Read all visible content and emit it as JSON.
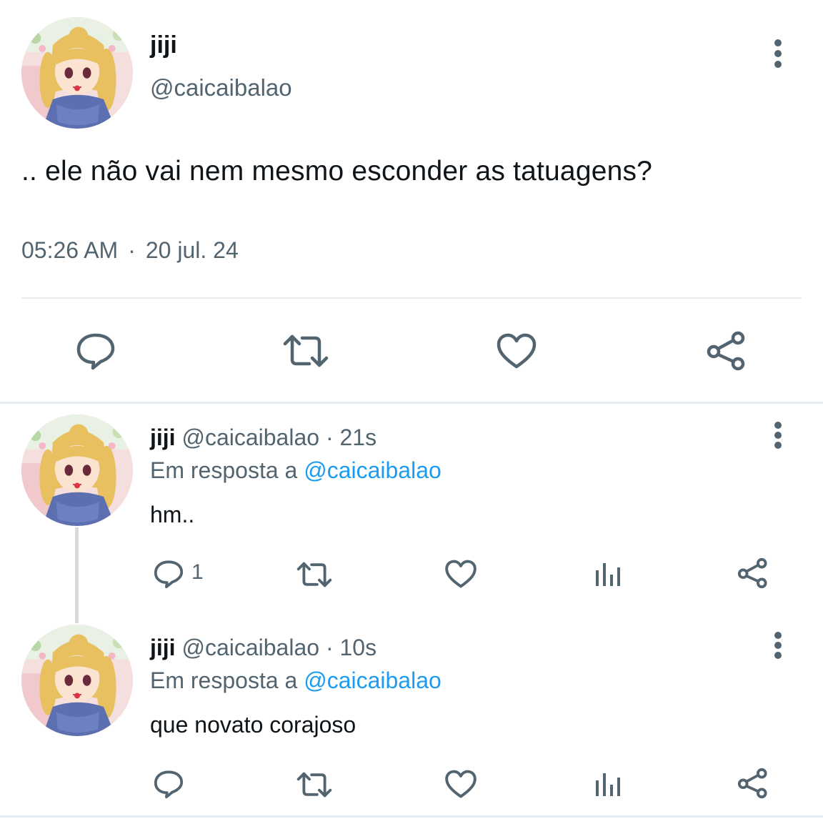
{
  "main_tweet": {
    "display_name": "jiji",
    "handle": "@caicaibalao",
    "text": ".. ele não vai nem mesmo esconder as tatuagens?",
    "time": "05:26 AM",
    "separator": "·",
    "date": "20 jul. 24",
    "actions": [
      "reply-icon",
      "retweet-icon",
      "like-icon",
      "share-icon"
    ]
  },
  "replies": [
    {
      "display_name": "jiji",
      "handle": "@caicaibalao",
      "age": "· 21s",
      "reply_prefix": "Em resposta a",
      "reply_to": "@caicaibalao",
      "text": "hm..",
      "reply_count": "1"
    },
    {
      "display_name": "jiji",
      "handle": "@caicaibalao",
      "age": "· 10s",
      "reply_prefix": "Em resposta a",
      "reply_to": "@caicaibalao",
      "text": "que novato corajoso",
      "reply_count": ""
    }
  ],
  "colors": {
    "icon": "#536471",
    "link": "#1d9bf0",
    "text": "#0f1419",
    "secondary": "#536471"
  }
}
